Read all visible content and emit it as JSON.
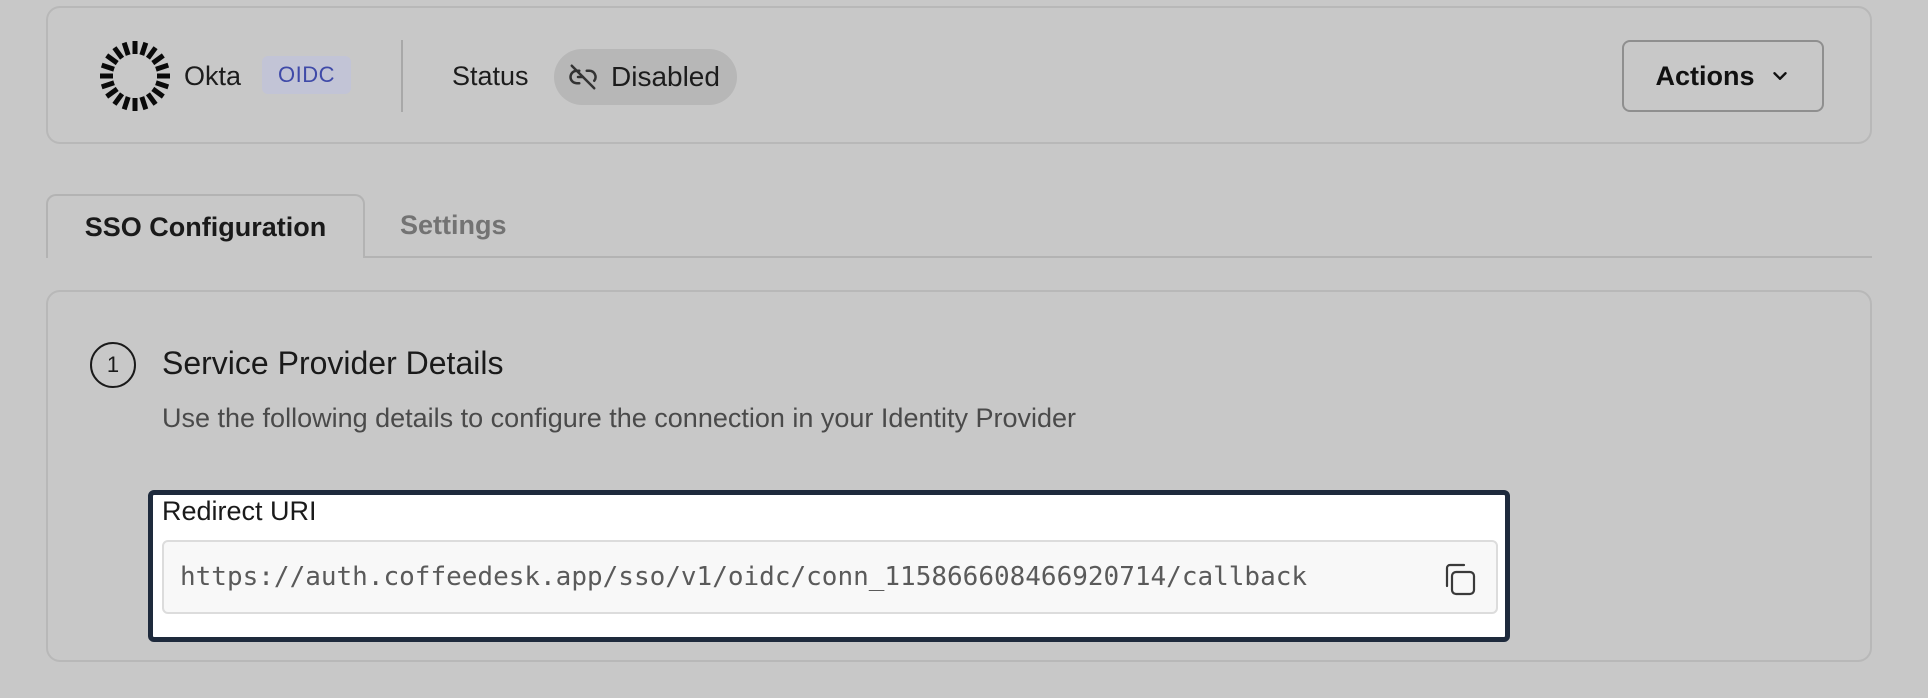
{
  "header": {
    "provider_name": "Okta",
    "protocol_badge": "OIDC",
    "status_label": "Status",
    "status_value": "Disabled",
    "actions_label": "Actions",
    "icons": {
      "logo": "okta-sunburst-logo",
      "status": "link-broken-icon",
      "actions": "chevron-down-icon"
    }
  },
  "tabs": [
    {
      "label": "SSO Configuration",
      "active": true
    },
    {
      "label": "Settings",
      "active": false
    }
  ],
  "section": {
    "step_number": "1",
    "title": "Service Provider Details",
    "description": "Use the following details to configure the connection in your Identity Provider",
    "field": {
      "label": "Redirect URI",
      "value": "https://auth.coffeedesk.app/sso/v1/oidc/conn_115866608466920714/callback",
      "icon": "copy-icon"
    }
  },
  "colors": {
    "background": "#c8c8c8",
    "badge_bg": "#c2c4d6",
    "badge_text": "#3f4aa8",
    "focus_border": "#1e2a3c"
  }
}
